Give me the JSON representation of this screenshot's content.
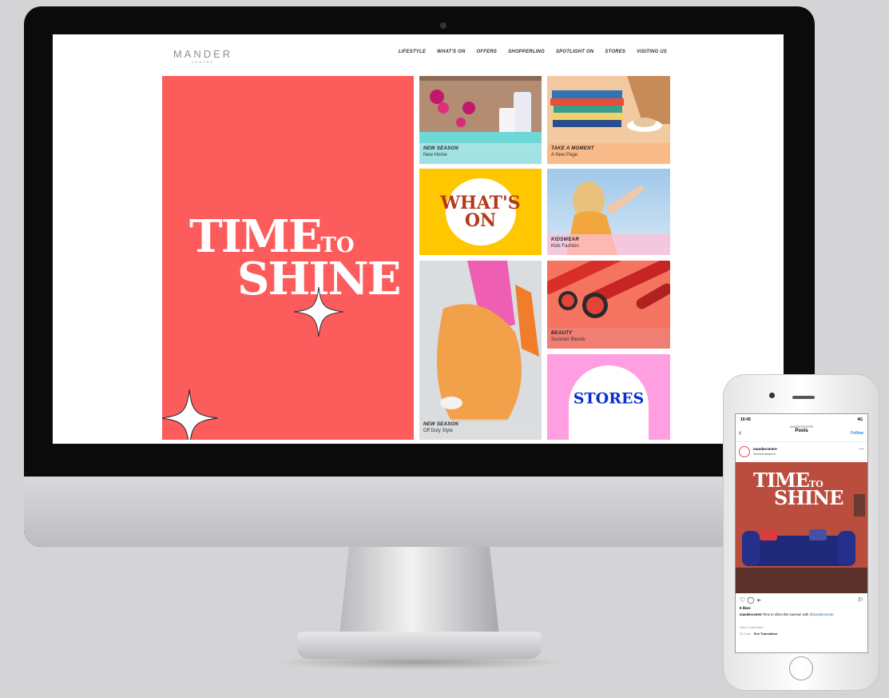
{
  "site": {
    "logo": "MANDER",
    "logo_sub": "CENTRE",
    "nav": [
      "LIFESTYLE",
      "WHAT'S ON",
      "OFFERS",
      "SHOPPERLING",
      "SPOTLIGHT ON",
      "STORES",
      "VISITING US"
    ]
  },
  "hero": {
    "line1": "TIME",
    "line1b": "TO",
    "line2": "SHINE"
  },
  "tiles": [
    {
      "title": "NEW SEASON",
      "subtitle": "New Home"
    },
    {
      "title": "TAKE A MOMENT",
      "subtitle": "A New Page"
    },
    {
      "label": "WHAT'S ON"
    },
    {
      "title": "KIDSWEAR",
      "subtitle": "Kids Fashion"
    },
    {
      "title": "NEW SEASON",
      "subtitle": "Off Duty Style"
    },
    {
      "title": "BEAUTY",
      "subtitle": "Summer Blends"
    },
    {
      "label": "STORES"
    }
  ],
  "phone": {
    "time": "10:43",
    "signal": "4G",
    "header_user": "MANDERCENTRE",
    "header_title": "Posts",
    "back": "‹",
    "follow": "Follow",
    "username": "mandercentre",
    "location": "Wolverhampton",
    "post_line1": "TIME",
    "post_line1b": "TO",
    "post_line2": "SHINE",
    "likes": "5 likes",
    "caption_user": "mandercentre",
    "caption_text": " Time to shine this summer with ",
    "caption_tag": "@mandercentre",
    "view_comments": "View 1 comment",
    "date": "25 June",
    "see_translation": "See Translation"
  },
  "colors": {
    "hero": "#fd5c5c",
    "whats_on": "#ffc700",
    "stores": "#ff9ee0",
    "accent_text": "#0a2fcf"
  }
}
